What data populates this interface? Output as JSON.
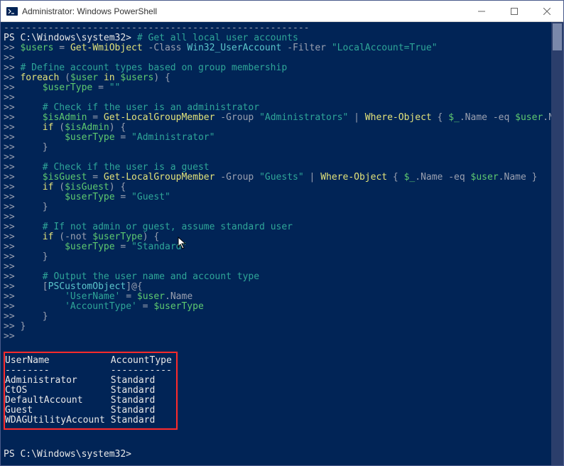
{
  "window": {
    "title": "Administrator: Windows PowerShell"
  },
  "prompt": {
    "path": "PS C:\\Windows\\system32>",
    "path2": "PS C:\\Windows\\system32>"
  },
  "code": {
    "c0": "# Get all local user accounts",
    "line1_a": "$users",
    "line1_b": " = ",
    "line1_c": "Get-WmiObject",
    "line1_d": " -Class ",
    "line1_e": "Win32_UserAccount",
    "line1_f": " -Filter ",
    "line1_g": "\"LocalAccount=True\"",
    "c1": "# Define account types based on group membership",
    "line2_a": "foreach",
    "line2_b": " (",
    "line2_c": "$user",
    "line2_d": " in ",
    "line2_e": "$users",
    "line2_f": ") {",
    "line3_a": "$userType",
    "line3_b": " = ",
    "line3_c": "\"\"",
    "c2": "# Check if the user is an administrator",
    "line4_a": "$isAdmin",
    "line4_b": " = ",
    "line4_c": "Get-LocalGroupMember",
    "line4_d": " -Group ",
    "line4_e": "\"Administrators\"",
    "line4_f": " | ",
    "line4_g": "Where-Object",
    "line4_h": " { ",
    "line4_i": "$_",
    "line4_j": ".Name ",
    "line4_k": "-eq",
    "line4_l": " ",
    "line4_m": "$user",
    "line4_n": ".Name }",
    "line5_a": "if",
    "line5_b": " (",
    "line5_c": "$isAdmin",
    "line5_d": ") {",
    "line6_a": "$userType",
    "line6_b": " = ",
    "line6_c": "\"Administrator\"",
    "line7": "}",
    "c3": "# Check if the user is a guest",
    "line8_a": "$isGuest",
    "line8_b": " = ",
    "line8_c": "Get-LocalGroupMember",
    "line8_d": " -Group ",
    "line8_e": "\"Guests\"",
    "line8_f": " | ",
    "line8_g": "Where-Object",
    "line8_h": " { ",
    "line8_i": "$_",
    "line8_j": ".Name ",
    "line8_k": "-eq",
    "line8_l": " ",
    "line8_m": "$user",
    "line8_n": ".Name }",
    "line9_a": "if",
    "line9_b": " (",
    "line9_c": "$isGuest",
    "line9_d": ") {",
    "line10_a": "$userType",
    "line10_b": " = ",
    "line10_c": "\"Guest\"",
    "line11": "}",
    "c4": "# If not admin or guest, assume standard user",
    "line12_a": "if",
    "line12_b": " (",
    "line12_c": "-not",
    "line12_d": " ",
    "line12_e": "$userType",
    "line12_f": ") {",
    "line13_a": "$userType",
    "line13_b": " = ",
    "line13_c": "\"Standard\"",
    "line14": "}",
    "c5": "# Output the user name and account type",
    "line15_a": "[",
    "line15_b": "PSCustomObject",
    "line15_c": "]@{",
    "line16_a": "'UserName'",
    "line16_b": " = ",
    "line16_c": "$user",
    "line16_d": ".Name",
    "line17_a": "'AccountType'",
    "line17_b": " = ",
    "line17_c": "$userType",
    "line18": "}",
    "line19": "}"
  },
  "output": {
    "hdr_user": "UserName",
    "hdr_type": "AccountType",
    "dash_user": "--------",
    "dash_type": "-----------",
    "rows": [
      {
        "user": "Administrator",
        "type": "Standard"
      },
      {
        "user": "CtOS",
        "type": "Standard"
      },
      {
        "user": "DefaultAccount",
        "type": "Standard"
      },
      {
        "user": "Guest",
        "type": "Standard"
      },
      {
        "user": "WDAGUtilityAccount",
        "type": "Standard"
      }
    ]
  },
  "cont": ">>"
}
